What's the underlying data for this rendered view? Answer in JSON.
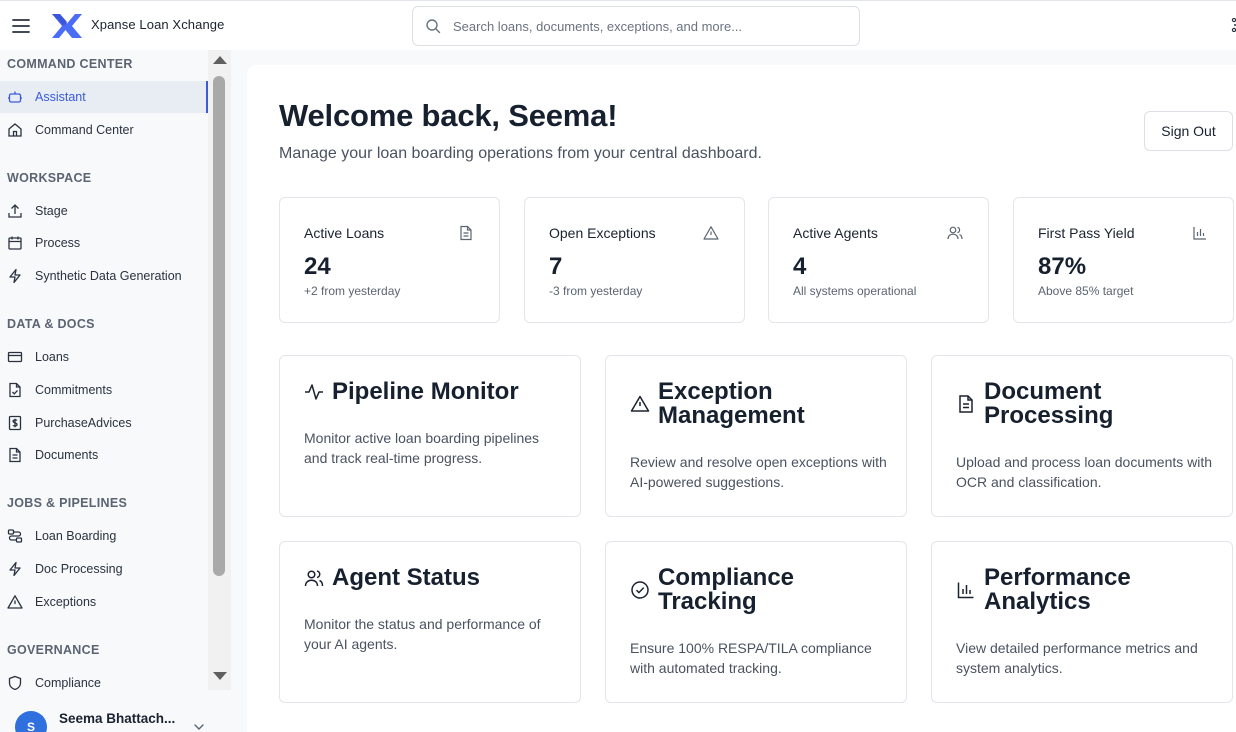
{
  "app": {
    "title": "Xpanse Loan Xchange"
  },
  "search": {
    "placeholder": "Search loans, documents, exceptions, and more..."
  },
  "sidebar": {
    "sections": [
      {
        "title": "COMMAND CENTER",
        "items": [
          {
            "label": "Assistant",
            "icon": "bot-icon",
            "active": true
          },
          {
            "label": "Command Center",
            "icon": "home-icon"
          }
        ]
      },
      {
        "title": "WORKSPACE",
        "items": [
          {
            "label": "Stage",
            "icon": "upload-icon"
          },
          {
            "label": "Process",
            "icon": "calendar-icon"
          },
          {
            "label": "Synthetic Data Generation",
            "icon": "bolt-icon"
          }
        ]
      },
      {
        "title": "DATA & DOCS",
        "items": [
          {
            "label": "Loans",
            "icon": "credit-card-icon"
          },
          {
            "label": "Commitments",
            "icon": "file-check-icon"
          },
          {
            "label": "PurchaseAdvices",
            "icon": "receipt-dollar-icon"
          },
          {
            "label": "Documents",
            "icon": "file-text-icon"
          }
        ]
      },
      {
        "title": "JOBS & PIPELINES",
        "items": [
          {
            "label": "Loan Boarding",
            "icon": "workflow-icon"
          },
          {
            "label": "Doc Processing",
            "icon": "bolt-icon"
          },
          {
            "label": "Exceptions",
            "icon": "warning-icon"
          }
        ]
      },
      {
        "title": "GOVERNANCE",
        "items": [
          {
            "label": "Compliance",
            "icon": "shield-icon"
          }
        ]
      }
    ],
    "user": {
      "initial": "S",
      "name": "Seema Bhattach..."
    }
  },
  "main": {
    "welcome": "Welcome back, Seema!",
    "subtitle": "Manage your loan boarding operations from your central dashboard.",
    "sign_out": "Sign Out",
    "stats": [
      {
        "label": "Active Loans",
        "value": "24",
        "note": "+2 from yesterday",
        "icon": "file-text-icon"
      },
      {
        "label": "Open Exceptions",
        "value": "7",
        "note": "-3 from yesterday",
        "icon": "warning-icon"
      },
      {
        "label": "Active Agents",
        "value": "4",
        "note": "All systems operational",
        "icon": "users-icon"
      },
      {
        "label": "First Pass Yield",
        "value": "87%",
        "note": "Above 85% target",
        "icon": "bar-chart-icon"
      }
    ],
    "cards": [
      {
        "title": "Pipeline Monitor",
        "desc": "Monitor active loan boarding pipelines and track real-time progress.",
        "icon": "activity-icon"
      },
      {
        "title": "Exception Management",
        "desc": "Review and resolve open exceptions with AI-powered suggestions.",
        "icon": "warning-icon"
      },
      {
        "title": "Document Processing",
        "desc": "Upload and process loan documents with OCR and classification.",
        "icon": "file-text-icon"
      },
      {
        "title": "Agent Status",
        "desc": "Monitor the status and performance of your AI agents.",
        "icon": "users-icon"
      },
      {
        "title": "Compliance Tracking",
        "desc": "Ensure 100% RESPA/TILA compliance with automated tracking.",
        "icon": "check-circle-icon"
      },
      {
        "title": "Performance Analytics",
        "desc": "View detailed performance metrics and system analytics.",
        "icon": "bar-chart-icon"
      }
    ]
  },
  "colors": {
    "accent": "#3b5bdb",
    "avatar": "#2f6fde",
    "text": "#16202e",
    "muted": "#5b6472"
  }
}
